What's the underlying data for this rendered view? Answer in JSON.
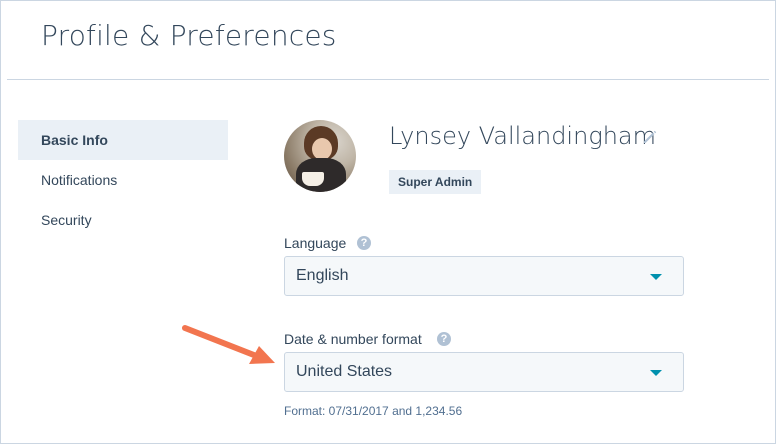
{
  "header": {
    "title": "Profile & Preferences"
  },
  "sidebar": {
    "items": [
      {
        "label": "Basic Info",
        "active": true
      },
      {
        "label": "Notifications",
        "active": false
      },
      {
        "label": "Security",
        "active": false
      }
    ]
  },
  "profile": {
    "name": "Lynsey Vallandingham",
    "role": "Super Admin",
    "avatar_icon": "user-photo",
    "edit_icon": "pencil-icon"
  },
  "language": {
    "label": "Language",
    "help_icon": "question-icon",
    "selected": "English"
  },
  "date_format": {
    "label": "Date & number format",
    "help_icon": "question-icon",
    "selected": "United States",
    "help_text": "Format: 07/31/2017 and 1,234.56"
  },
  "colors": {
    "accent": "#0091ae",
    "annotation_arrow": "#f2754f",
    "active_nav_bg": "#eaf0f6",
    "text": "#33475b"
  }
}
